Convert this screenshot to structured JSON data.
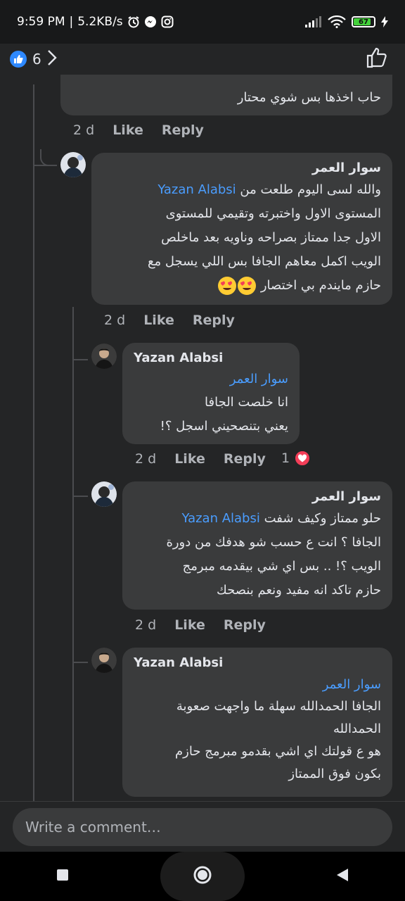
{
  "status_bar": {
    "time": "9:59 PM",
    "separator": "|",
    "speed": "5.2KB/s",
    "battery": "67"
  },
  "header": {
    "like_count": "6"
  },
  "comments": [
    {
      "text": "حاب اخذها بس شوي محتار",
      "time": "2 d",
      "like": "Like",
      "reply": "Reply"
    },
    {
      "author": "سوار العمر",
      "mention": "Yazan Alabsi",
      "line1_rest": "والله لسى اليوم طلعت من",
      "line2": "المستوى الاول واختبرته وتقيمي للمستوى",
      "line3": "الاول جدا ممتاز بصراحه وناويه بعد ماخلص",
      "line4": "الويب اكمل معاهم الجافا بس اللي يسجل مع",
      "line5": "حازم مايندم بي اختصار",
      "time": "2 d",
      "like": "Like",
      "reply": "Reply"
    },
    {
      "author": "Yazan Alabsi",
      "mention": "سوار العمر",
      "line1": "انا خلصت الجافا",
      "line2": "يعني بتنصحيني اسجل ؟!",
      "time": "2 d",
      "like": "Like",
      "reply": "Reply",
      "reaction_count": "1"
    },
    {
      "author": "سوار العمر",
      "mention": "Yazan Alabsi",
      "line1_rest": "حلو ممتاز وكيف شفت",
      "line2": "الجافا ؟ انت ع حسب شو هدفك من دورة",
      "line3": "الويب ؟! .. بس اي شي بيقدمه مبرمج",
      "line4": "حازم تاكد انه مفيد ونعم بنصحك",
      "time": "2 d",
      "like": "Like",
      "reply": "Reply"
    },
    {
      "author": "Yazan Alabsi",
      "mention": "سوار العمر",
      "line1": "الجافا الحمدالله سهلة ما واجهت صعوبة",
      "line2": "الحمدالله",
      "line3": "هو ع قولتك اي اشي بقدمو مبرمج حازم",
      "line4": "بكون فوق الممتاز"
    }
  ],
  "composer": {
    "placeholder": "Write a comment…"
  },
  "colors": {
    "background": "#242526",
    "bubble": "#3a3b3c",
    "mention": "#4a9dff",
    "like_blue": "#2e89ff",
    "heart_red": "#f33e58"
  }
}
